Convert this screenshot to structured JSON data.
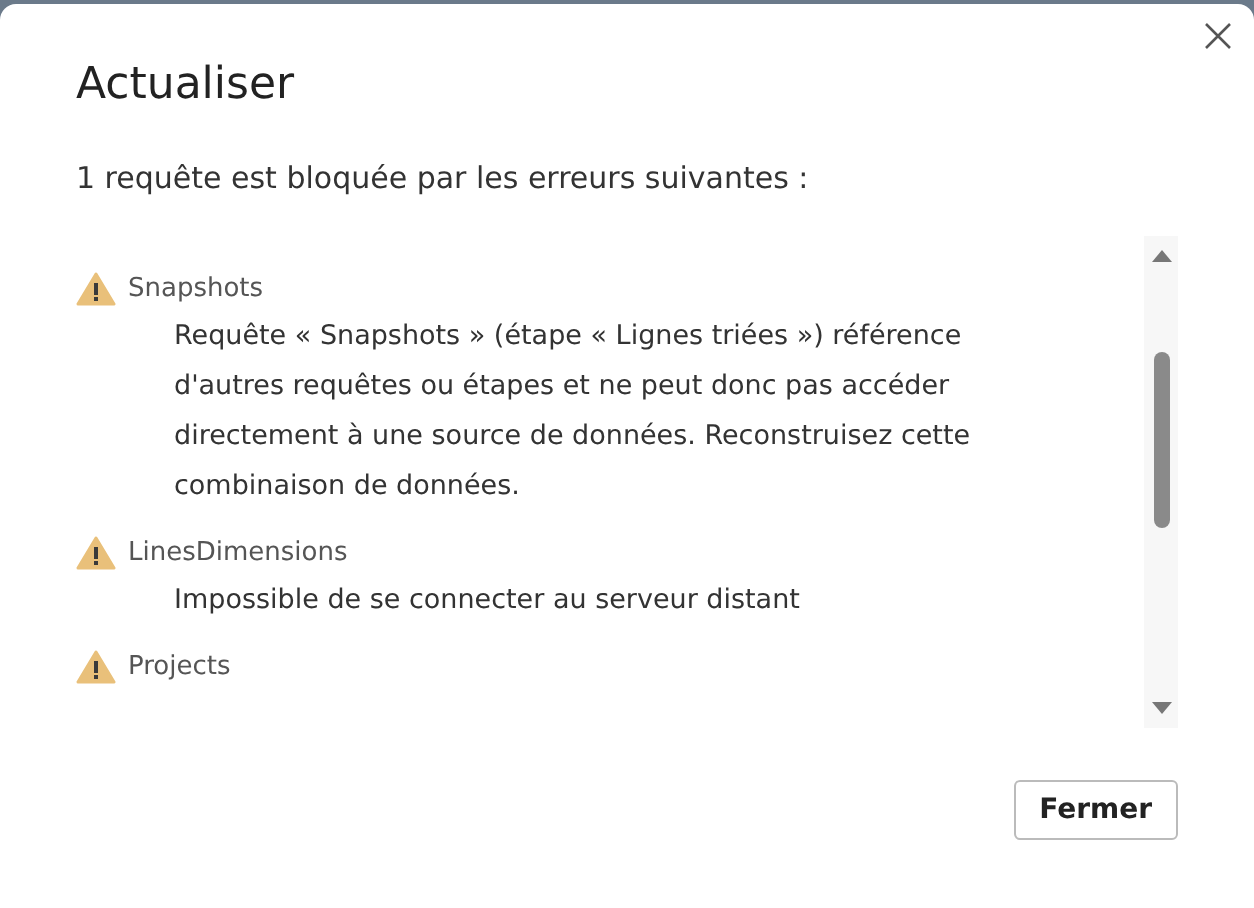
{
  "dialog": {
    "title": "Actualiser",
    "message": "1 requête est bloquée par les erreurs suivantes :",
    "errors": [
      {
        "query": "Snapshots",
        "detail": "Requête « Snapshots » (étape « Lignes triées ») référence d'autres requêtes ou étapes et ne peut donc pas accéder directement à une source de données. Reconstruisez cette combinaison de données."
      },
      {
        "query": "LinesDimensions",
        "detail": "Impossible de se connecter au serveur distant"
      },
      {
        "query": "Projects"
      }
    ],
    "buttons": [
      "Fermer"
    ]
  }
}
